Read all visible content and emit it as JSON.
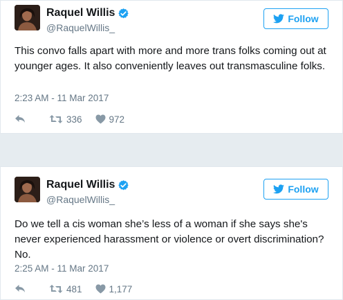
{
  "tweets": [
    {
      "name": "Raquel Willis",
      "handle": "@RaquelWillis_",
      "follow_label": "Follow",
      "text": "This convo falls apart with more and more trans folks coming out at younger ages. It also conveniently leaves out transmasculine folks.",
      "timestamp": "2:23 AM - 11 Mar 2017",
      "retweets": "336",
      "likes": "972"
    },
    {
      "name": "Raquel Willis",
      "handle": "@RaquelWillis_",
      "follow_label": "Follow",
      "text": "Do we tell a cis woman she’s less of a woman if she says she's never experienced harassment or violence or overt discrimination? No.",
      "timestamp": "2:25 AM - 11 Mar 2017",
      "retweets": "481",
      "likes": "1,177"
    }
  ],
  "colors": {
    "brand_blue": "#1da1f2",
    "muted": "#657786",
    "icon_grey": "#8899a6",
    "text": "#14171a",
    "page_bg": "#e6ecf0"
  },
  "icons": [
    "verified-badge-icon",
    "twitter-bird-icon",
    "reply-icon",
    "retweet-icon",
    "heart-icon"
  ]
}
